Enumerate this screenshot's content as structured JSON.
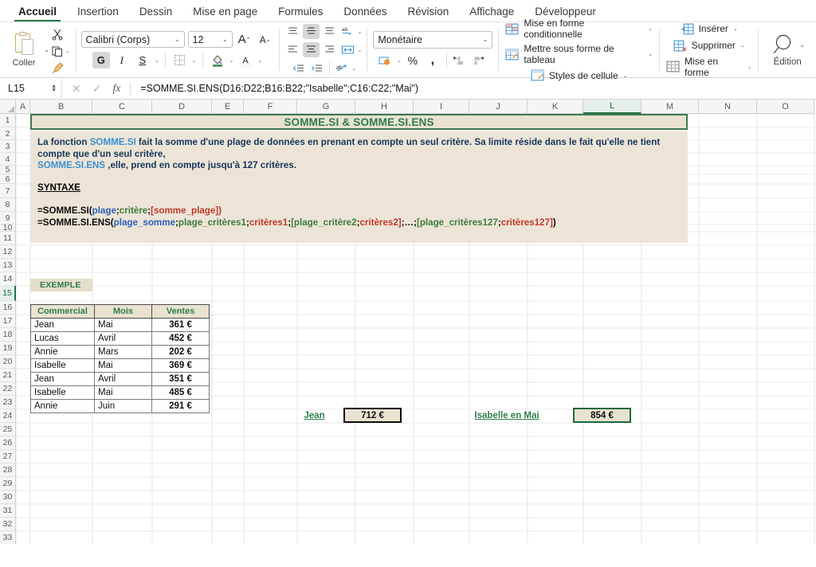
{
  "ribbon": {
    "tabs": [
      {
        "label": "Accueil",
        "active": true
      },
      {
        "label": "Insertion",
        "active": false
      },
      {
        "label": "Dessin",
        "active": false
      },
      {
        "label": "Mise en page",
        "active": false
      },
      {
        "label": "Formules",
        "active": false
      },
      {
        "label": "Données",
        "active": false
      },
      {
        "label": "Révision",
        "active": false
      },
      {
        "label": "Affichage",
        "active": false
      },
      {
        "label": "Développeur",
        "active": false
      }
    ],
    "clipboard": {
      "paste_label": "Coller"
    },
    "font": {
      "family": "Calibri (Corps)",
      "size": "12",
      "bold_label": "G",
      "italic_label": "I",
      "underline_label": "S",
      "font_color_label": "A",
      "grow_label": "A",
      "shrink_label": "A"
    },
    "number": {
      "format": "Monétaire",
      "percent_label": "%",
      "comma_label": ","
    },
    "styles": {
      "conditional": "Mise en forme conditionnelle",
      "table": "Mettre sous forme de tableau",
      "cell_styles": "Styles de cellule"
    },
    "cells": {
      "insert": "Insérer",
      "delete": "Supprimer",
      "format": "Mise en forme"
    },
    "editing": {
      "label": "Édition"
    }
  },
  "formula_bar": {
    "name_box": "L15",
    "formula": "=SOMME.SI.ENS(D16:D22;B16:B22;\"Isabelle\";C16:C22;\"Mai\")"
  },
  "grid": {
    "columns": [
      {
        "label": "A",
        "width": 18
      },
      {
        "label": "B",
        "width": 78
      },
      {
        "label": "C",
        "width": 75
      },
      {
        "label": "D",
        "width": 75
      },
      {
        "label": "E",
        "width": 40
      },
      {
        "label": "F",
        "width": 67
      },
      {
        "label": "G",
        "width": 73
      },
      {
        "label": "H",
        "width": 73
      },
      {
        "label": "I",
        "width": 70
      },
      {
        "label": "J",
        "width": 73
      },
      {
        "label": "K",
        "width": 70
      },
      {
        "label": "L",
        "width": 73,
        "selected": true
      },
      {
        "label": "M",
        "width": 72
      },
      {
        "label": "N",
        "width": 73
      },
      {
        "label": "O",
        "width": 72
      }
    ],
    "rows": [
      {
        "label": "1",
        "height": 17
      },
      {
        "label": "2",
        "height": 16
      },
      {
        "label": "3",
        "height": 16
      },
      {
        "label": "4",
        "height": 16
      },
      {
        "label": "5",
        "height": 11
      },
      {
        "label": "6",
        "height": 12
      },
      {
        "label": "7",
        "height": 18
      },
      {
        "label": "8",
        "height": 17
      },
      {
        "label": "9",
        "height": 16
      },
      {
        "label": "10",
        "height": 9
      },
      {
        "label": "11",
        "height": 17
      },
      {
        "label": "12",
        "height": 17
      },
      {
        "label": "13",
        "height": 17
      },
      {
        "label": "14",
        "height": 17
      },
      {
        "label": "15",
        "height": 19,
        "selected": true
      },
      {
        "label": "16",
        "height": 17
      },
      {
        "label": "17",
        "height": 17
      },
      {
        "label": "18",
        "height": 17
      },
      {
        "label": "19",
        "height": 17
      },
      {
        "label": "20",
        "height": 17
      },
      {
        "label": "21",
        "height": 17
      },
      {
        "label": "22",
        "height": 17
      },
      {
        "label": "23",
        "height": 17
      },
      {
        "label": "24",
        "height": 17
      },
      {
        "label": "25",
        "height": 17
      },
      {
        "label": "26",
        "height": 17
      },
      {
        "label": "27",
        "height": 17
      },
      {
        "label": "28",
        "height": 17
      },
      {
        "label": "29",
        "height": 17
      },
      {
        "label": "30",
        "height": 17
      },
      {
        "label": "31",
        "height": 17
      },
      {
        "label": "32",
        "height": 17
      },
      {
        "label": "33",
        "height": 17
      }
    ]
  },
  "sheet": {
    "banner_title": "SOMME.SI & SOMME.SI.ENS",
    "description": {
      "line1_pre": "La fonction ",
      "line1_fn": "SOMME.SI",
      "line1_post": " fait la somme d'une plage de données en prenant en compte un seul critère. Sa limite réside dans le fait qu'elle ne tient compte que d'un seul critère,",
      "line2_fn": "SOMME.SI.ENS",
      "line2_post": " ,elle, prend en compte jusqu'à 127 critères."
    },
    "syntaxe_heading": "SYNTAXE",
    "syntax1": {
      "p1": "=SOMME.SI(",
      "a1": "plage",
      "s1": ";",
      "a2": "critère",
      "s2": ";",
      "a3": "[somme_plage])"
    },
    "syntax2": {
      "p1": "=SOMME.SI.ENS(",
      "a1": "plage_somme",
      "s1": ";",
      "a2": "plage_critères1",
      "s2": ";",
      "a3": "critères1",
      "s3": ";",
      "a4": "[plage_critère2",
      "s4": ";",
      "a5": "critères2]",
      "s5": ";…;",
      "a6": "[plage_critères127",
      "s6": ";",
      "a7": "critères127]",
      "s7": ")"
    },
    "exemple_label": "EXEMPLE",
    "table": {
      "headers": [
        "Commercial",
        "Mois",
        "Ventes"
      ],
      "rows": [
        [
          "Jean",
          "Mai",
          "361 €"
        ],
        [
          "Lucas",
          "Avril",
          "452 €"
        ],
        [
          "Annie",
          "Mars",
          "202 €"
        ],
        [
          "Isabelle",
          "Mai",
          "369 €"
        ],
        [
          "Jean",
          "Avril",
          "351 €"
        ],
        [
          "Isabelle",
          "Mai",
          "485 €"
        ],
        [
          "Annie",
          "Juin",
          "291 €"
        ]
      ]
    },
    "results": {
      "label1": "Jean",
      "value1": "712 €",
      "label2": "Isabelle en Mai",
      "value2": "854 €"
    }
  },
  "colors": {
    "accent_green": "#217346",
    "banner_bg": "#e9e2d0",
    "banner_text": "#2e7d4f",
    "desc_text": "#17365d",
    "link_blue": "#3d8fd1",
    "arg_blue": "#2f5fb8",
    "arg_green": "#3f7a3f",
    "arg_red": "#c0392b"
  }
}
